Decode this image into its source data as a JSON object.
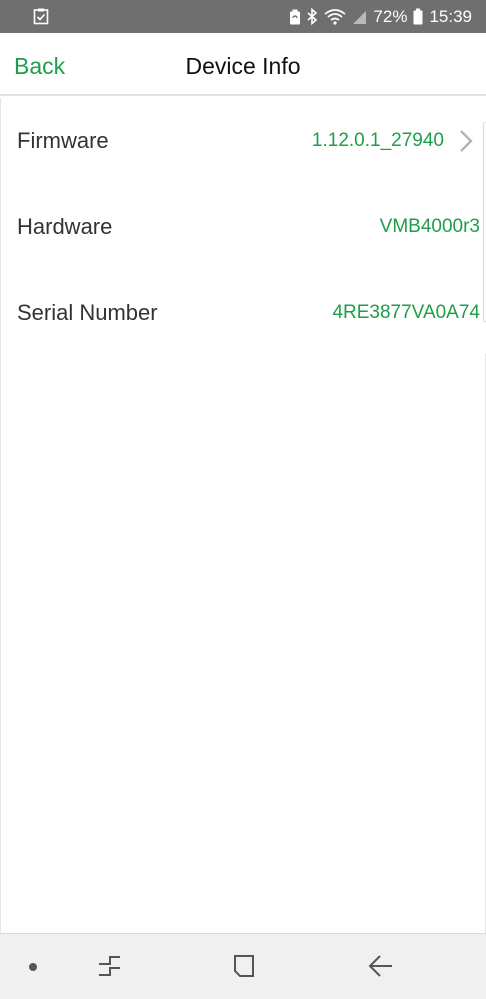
{
  "status_bar": {
    "battery_percent": "72%",
    "time": "15:39",
    "icons": [
      "checklist-icon",
      "battery-saver-icon",
      "bluetooth-icon",
      "wifi-icon",
      "signal-icon",
      "battery-icon"
    ]
  },
  "header": {
    "back_label": "Back",
    "title": "Device Info"
  },
  "device_info": {
    "rows": [
      {
        "label": "Firmware",
        "value": "1.12.0.1_27940",
        "has_chevron": true
      },
      {
        "label": "Hardware",
        "value": "VMB4000r3",
        "has_chevron": false
      },
      {
        "label": "Serial Number",
        "value": "4RE3877VA0A74",
        "has_chevron": false
      }
    ]
  },
  "system_nav": {
    "icons": [
      "dot-icon",
      "recent-apps-icon",
      "home-icon",
      "back-arrow-icon"
    ]
  },
  "colors": {
    "accent": "#1e9e4a",
    "status_bar": "#6f6f6f"
  }
}
